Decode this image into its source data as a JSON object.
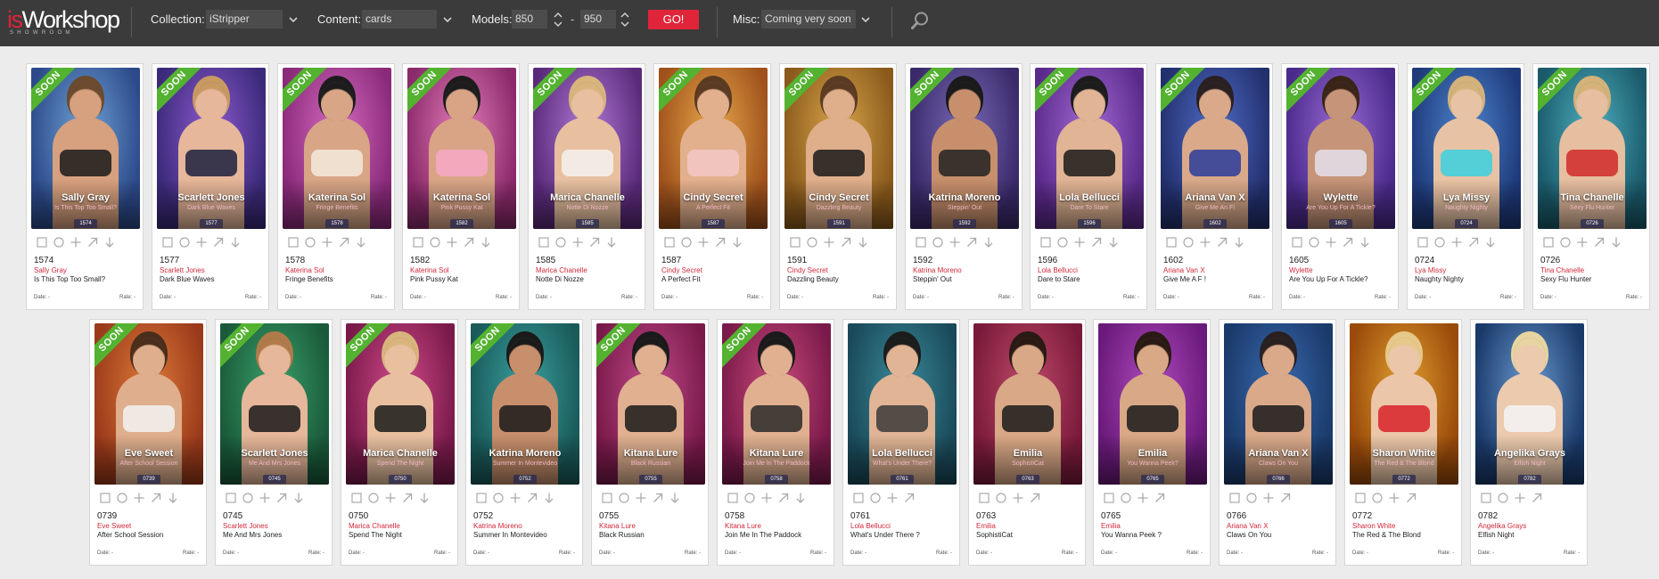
{
  "logo": {
    "prefix": "is",
    "main": "Workshop",
    "sub": "SHOWROOM"
  },
  "toolbar": {
    "collection_label": "Collection:",
    "collection_value": "iStripper",
    "content_label": "Content:",
    "content_value": "cards",
    "models_label": "Models:",
    "models_from": "850",
    "models_to": "950",
    "range_dash": "-",
    "go_label": "GO!",
    "misc_label": "Misc:",
    "misc_value": "Coming very soon",
    "search_icon": "magnifier-icon"
  },
  "soon_label": "SOON",
  "date_label": "Date:",
  "date_value": "-",
  "rate_label": "Rate:",
  "rate_value": "-",
  "card_icons": [
    "square-icon",
    "circle-icon",
    "plus-icon",
    "arrow-up-right-icon",
    "arrow-down-icon"
  ],
  "colors": {
    "accent": "#e0243a",
    "soon_ribbon": "#54b231",
    "topbar": "#3b3b3b",
    "artist_text": "#d0283a"
  },
  "cards": [
    {
      "num": "1574",
      "artist": "Sally Gray",
      "title": "Is This Top Too Small?",
      "thumb_sub": "Is This Top Too Small?",
      "soon": true,
      "icons": 5,
      "c1": "#2c4a8a",
      "c2": "#6fa3d6",
      "skin": "#d7a07e",
      "hair": "#6b4a2e",
      "cloth": "#1a1a1a"
    },
    {
      "num": "1577",
      "artist": "Scarlett Jones",
      "title": "Dark Blue Waves",
      "thumb_sub": "Dark Blue Waves",
      "soon": true,
      "icons": 5,
      "c1": "#3b2a7a",
      "c2": "#8e5bd0",
      "skin": "#e6b79a",
      "hair": "#c89a62",
      "cloth": "#1b2140"
    },
    {
      "num": "1578",
      "artist": "Katerina Sol",
      "title": "Fringe Benefits",
      "thumb_sub": "Fringe Benefits",
      "soon": true,
      "icons": 5,
      "c1": "#8a2a7a",
      "c2": "#d66bc0",
      "skin": "#d8a586",
      "hair": "#1c1c1c",
      "cloth": "#f4eadc"
    },
    {
      "num": "1582",
      "artist": "Katerina Sol",
      "title": "Pink Pussy Kat",
      "thumb_sub": "Pink Pussy Kat",
      "soon": true,
      "icons": 5,
      "c1": "#8a2a6a",
      "c2": "#e67dbb",
      "skin": "#d9a486",
      "hair": "#1c1c1c",
      "cloth": "#f7a9c8"
    },
    {
      "num": "1585",
      "artist": "Marica Chanelle",
      "title": "Notte Di Nozze",
      "thumb_sub": "Notte Di Nozze",
      "soon": true,
      "icons": 5,
      "c1": "#5a2a7a",
      "c2": "#b07ad6",
      "skin": "#e8c0a0",
      "hair": "#d8b57c",
      "cloth": "#f5f2ee"
    },
    {
      "num": "1587",
      "artist": "Cindy Secret",
      "title": "A Perfect Fit",
      "thumb_sub": "A Perfect Fit",
      "soon": true,
      "icons": 5,
      "c1": "#a0521c",
      "c2": "#e9a84a",
      "skin": "#e3b08e",
      "hair": "#5a3a22",
      "cloth": "#f3c9c6"
    },
    {
      "num": "1591",
      "artist": "Cindy Secret",
      "title": "Dazzling Beauty",
      "thumb_sub": "Dazzling Beauty",
      "soon": true,
      "icons": 5,
      "c1": "#8a5a1c",
      "c2": "#d9a64a",
      "skin": "#dfae8a",
      "hair": "#5a3a22",
      "cloth": "#1a1a1a"
    },
    {
      "num": "1592",
      "artist": "Katrina Moreno",
      "title": "Steppin' Out",
      "thumb_sub": "Steppin' Out",
      "soon": true,
      "icons": 5,
      "c1": "#3a2a6a",
      "c2": "#7a6ab8",
      "skin": "#c78f6c",
      "hair": "#1a1a1a",
      "cloth": "#222222"
    },
    {
      "num": "1596",
      "artist": "Lola Bellucci",
      "title": "Dare to Stare",
      "thumb_sub": "Dare To Stare",
      "soon": true,
      "icons": 5,
      "c1": "#5a2a8a",
      "c2": "#a46ad6",
      "skin": "#e0b494",
      "hair": "#1c1c1c",
      "cloth": "#1a1a1a"
    },
    {
      "num": "1602",
      "artist": "Ariana Van X",
      "title": "Give Me A F !",
      "thumb_sub": "Give Me An F!",
      "soon": true,
      "icons": 5,
      "c1": "#23306e",
      "c2": "#4f6cc7",
      "skin": "#d9a98a",
      "hair": "#2a2020",
      "cloth": "#2a3d9a"
    },
    {
      "num": "1605",
      "artist": "Wylette",
      "title": "Are You Up For A Tickle?",
      "thumb_sub": "Are You Up For A Tickle?",
      "soon": true,
      "icons": 5,
      "c1": "#4a2a8a",
      "c2": "#9a6ad6",
      "skin": "#c69478",
      "hair": "#3a2418",
      "cloth": "#e4e0ec"
    },
    {
      "num": "0724",
      "artist": "Lya Missy",
      "title": "Naughty Nighty",
      "thumb_sub": "Naughty Nighty",
      "soon": true,
      "icons": 5,
      "c1": "#1e3a7a",
      "c2": "#4e86d0",
      "skin": "#e8c2a4",
      "hair": "#d4b27a",
      "cloth": "#3ad0e0"
    },
    {
      "num": "0726",
      "artist": "Tina Chanelle",
      "title": "Sexy Flu Hunter",
      "thumb_sub": "Sexy Flu Hunter",
      "soon": true,
      "icons": 5,
      "c1": "#1a5a6a",
      "c2": "#4eb0c0",
      "skin": "#e6bea0",
      "hair": "#d4b27a",
      "cloth": "#d02a2a"
    },
    {
      "num": "0739",
      "artist": "Eve Sweet",
      "title": "After School Session",
      "thumb_sub": "After School Session",
      "soon": true,
      "icons": 5,
      "c1": "#9a3a1a",
      "c2": "#e07a3a",
      "skin": "#dfae8c",
      "hair": "#4a2e1c",
      "cloth": "#f2f2f2"
    },
    {
      "num": "0745",
      "artist": "Scarlett Jones",
      "title": "Me And Mrs Jones",
      "thumb_sub": "Me And Mrs Jones",
      "soon": true,
      "icons": 5,
      "c1": "#1a5a3a",
      "c2": "#3aa06a",
      "skin": "#e6b79a",
      "hair": "#b07a4a",
      "cloth": "#1a1a1a"
    },
    {
      "num": "0750",
      "artist": "Marica Chanelle",
      "title": "Spend The Night",
      "thumb_sub": "Spend The Night",
      "soon": true,
      "icons": 5,
      "c1": "#7a1a4a",
      "c2": "#d04a8a",
      "skin": "#e8c0a0",
      "hair": "#d8b57c",
      "cloth": "#1a1a1a"
    },
    {
      "num": "0752",
      "artist": "Katrina Moreno",
      "title": "Summer In Montevideo",
      "thumb_sub": "Summer In Montevideo",
      "soon": true,
      "icons": 5,
      "c1": "#1a5a5a",
      "c2": "#3aa0a0",
      "skin": "#c78f6c",
      "hair": "#1a1a1a",
      "cloth": "#1a1a1a"
    },
    {
      "num": "0755",
      "artist": "Kitana Lure",
      "title": "Black Russian",
      "thumb_sub": "Black Russian",
      "soon": true,
      "icons": 5,
      "c1": "#7a1a4a",
      "c2": "#c04a8a",
      "skin": "#e0b090",
      "hair": "#1a1a1a",
      "cloth": "#1a1a1a"
    },
    {
      "num": "0758",
      "artist": "Kitana Lure",
      "title": "Join Me In The Paddock",
      "thumb_sub": "Join Me In The Paddock",
      "soon": true,
      "icons": 5,
      "c1": "#7a1a4a",
      "c2": "#c84a7a",
      "skin": "#e0b090",
      "hair": "#1a1a1a",
      "cloth": "#2a2a2a"
    },
    {
      "num": "0761",
      "artist": "Lola Bellucci",
      "title": "What's Under There ?",
      "thumb_sub": "What's Under There?",
      "soon": false,
      "icons": 4,
      "c1": "#1a4a5a",
      "c2": "#3a8a9a",
      "skin": "#e0b494",
      "hair": "#1c1c1c",
      "cloth": "#3a3a3a"
    },
    {
      "num": "0763",
      "artist": "Emilia",
      "title": "SophistiCat",
      "thumb_sub": "SophistiCat",
      "soon": false,
      "icons": 4,
      "c1": "#7a1a3a",
      "c2": "#c04a6a",
      "skin": "#d9a886",
      "hair": "#2a1a14",
      "cloth": "#1a1a1a"
    },
    {
      "num": "0765",
      "artist": "Emilia",
      "title": "You Wanna Peek ?",
      "thumb_sub": "You Wanna Peek?",
      "soon": false,
      "icons": 4,
      "c1": "#6a1a7a",
      "c2": "#b04ac0",
      "skin": "#d9a886",
      "hair": "#2a1a14",
      "cloth": "#1a1a1a"
    },
    {
      "num": "0766",
      "artist": "Ariana Van X",
      "title": "Claws On You",
      "thumb_sub": "Claws On You",
      "soon": false,
      "icons": 4,
      "c1": "#1a3a6a",
      "c2": "#3a6ab0",
      "skin": "#d9a98a",
      "hair": "#2a2020",
      "cloth": "#1a1a1a"
    },
    {
      "num": "0772",
      "artist": "Sharon White",
      "title": "The Red & The Blond",
      "thumb_sub": "The Red & The Blond",
      "soon": false,
      "icons": 4,
      "c1": "#9a4a0a",
      "c2": "#e0a030",
      "skin": "#ecc6a8",
      "hair": "#e6c88a",
      "cloth": "#d8222a"
    },
    {
      "num": "0782",
      "artist": "Angelika Grays",
      "title": "Elfish Night",
      "thumb_sub": "Elfish Night",
      "soon": false,
      "icons": 4,
      "c1": "#1a3a6a",
      "c2": "#6a9ad0",
      "skin": "#eccaae",
      "hair": "#e8d4a0",
      "cloth": "#f4f4f6"
    }
  ]
}
